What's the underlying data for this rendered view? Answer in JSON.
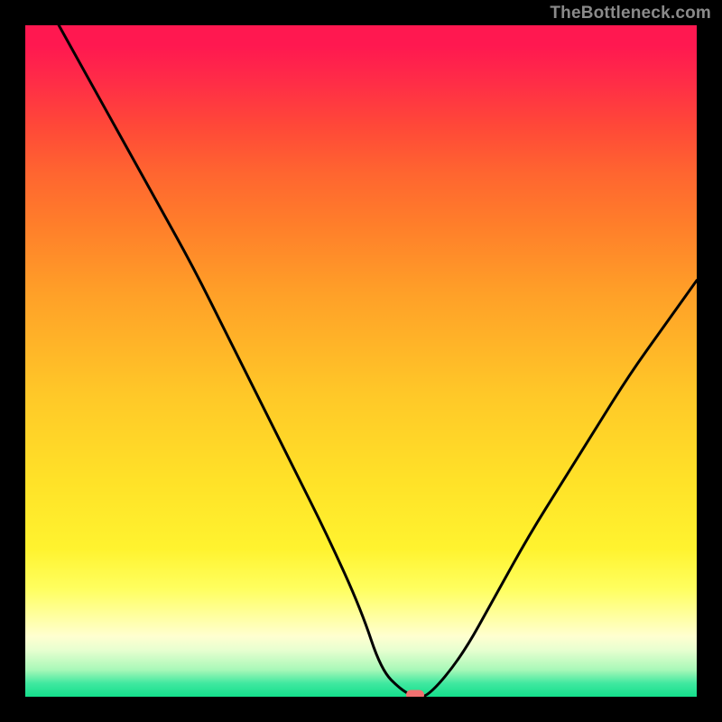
{
  "watermark": "TheBottleneck.com",
  "colors": {
    "curve": "#000000",
    "marker": "#f07070",
    "frame": "#000000"
  },
  "chart_data": {
    "type": "line",
    "title": "",
    "xlabel": "",
    "ylabel": "",
    "xlim": [
      0,
      100
    ],
    "ylim": [
      0,
      100
    ],
    "grid": false,
    "x": [
      0,
      5,
      10,
      15,
      20,
      25,
      30,
      35,
      40,
      45,
      50,
      53,
      56,
      58,
      60,
      65,
      70,
      75,
      80,
      85,
      90,
      95,
      100
    ],
    "values": [
      null,
      100,
      91,
      82,
      73,
      64,
      54,
      44,
      34,
      24,
      13,
      4,
      1,
      0,
      0,
      6,
      15,
      24,
      32,
      40,
      48,
      55,
      62
    ],
    "minimum_marker": {
      "x": 58,
      "y": 0
    },
    "background": "vertical red→yellow→green gradient (bottleneck severity scale)"
  }
}
